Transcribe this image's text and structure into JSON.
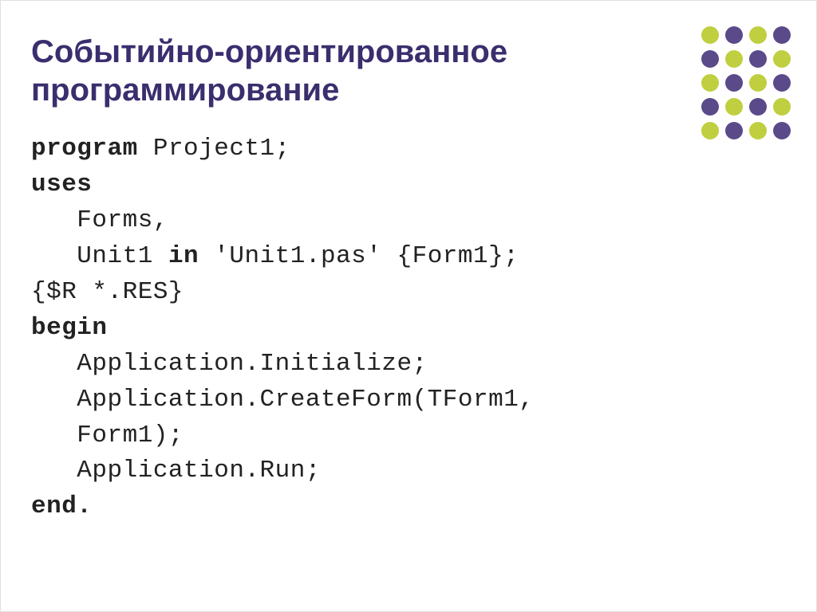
{
  "title": "Событийно-ориентированное программирование",
  "code": {
    "l1a": "program",
    "l1b": " Project1;",
    "l2": "uses",
    "l3": "   Forms,",
    "l4a": "   Unit1 ",
    "l4b": "in",
    "l4c": " 'Unit1.pas' {Form1};",
    "l5": "{$R *.RES}",
    "l6": "begin",
    "l7": "   Application.Initialize;",
    "l8": "   Application.CreateForm(TForm1,",
    "l9": "   Form1);",
    "l10": "   Application.Run;",
    "l11": "end."
  },
  "dot_colors": [
    "#bfcf3f",
    "#5a4a8a",
    "#bfcf3f",
    "#5a4a8a",
    "#5a4a8a",
    "#bfcf3f",
    "#5a4a8a",
    "#bfcf3f",
    "#bfcf3f",
    "#5a4a8a",
    "#bfcf3f",
    "#5a4a8a",
    "#5a4a8a",
    "#bfcf3f",
    "#5a4a8a",
    "#bfcf3f",
    "#bfcf3f",
    "#5a4a8a",
    "#bfcf3f",
    "#5a4a8a"
  ]
}
